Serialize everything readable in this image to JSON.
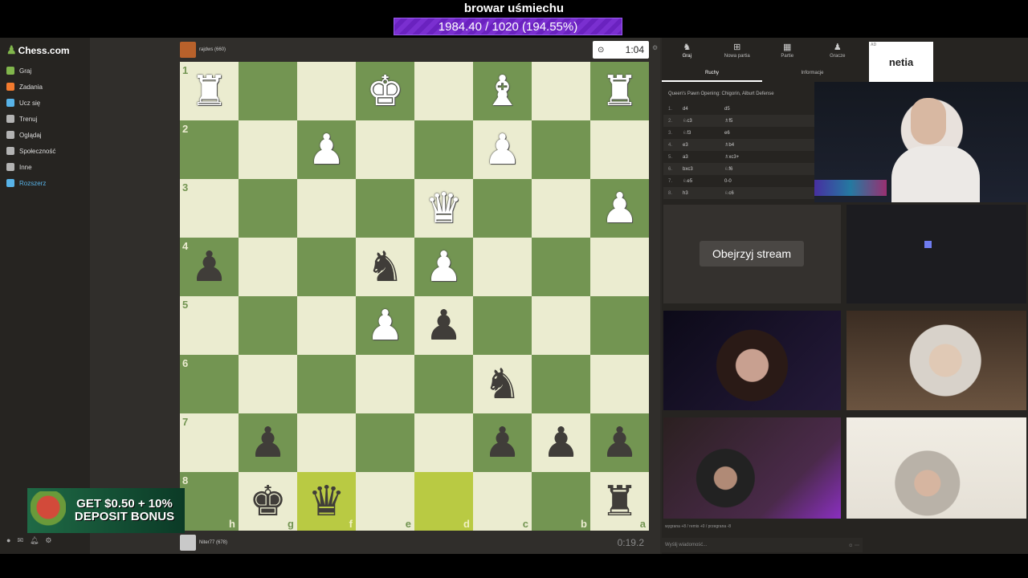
{
  "stream": {
    "title": "browar uśmiechu",
    "progress_text": "1984.40 / 1020 (194.55%)"
  },
  "sidebar": {
    "logo": "Chess.com",
    "items": [
      {
        "label": "Graj",
        "color": "#81b64c"
      },
      {
        "label": "Zadania",
        "color": "#f27a2e"
      },
      {
        "label": "Ucz się",
        "color": "#58b3e8"
      },
      {
        "label": "Trenuj",
        "color": "#b3b3b3"
      },
      {
        "label": "Oglądaj",
        "color": "#b3b3b3"
      },
      {
        "label": "Społeczność",
        "color": "#b3b3b3"
      },
      {
        "label": "Inne",
        "color": "#b3b3b3"
      },
      {
        "label": "Rozszerz",
        "color": "#58b3e8"
      }
    ]
  },
  "players": {
    "top": {
      "name": "rajdws (660)",
      "clock": "1:04"
    },
    "bottom": {
      "name": "Niter77 (678)",
      "clock": "0:19.2"
    }
  },
  "board": {
    "ranks": [
      "1",
      "2",
      "3",
      "4",
      "5",
      "6",
      "7",
      "8"
    ],
    "files": [
      "h",
      "g",
      "f",
      "e",
      "d",
      "c",
      "b",
      "a"
    ],
    "highlight": [
      "8-2",
      "8-4"
    ],
    "pieces": {
      "1-0": "wR",
      "1-3": "wK",
      "1-5": "wB",
      "1-7": "wR",
      "2-2": "wP",
      "2-5": "wP",
      "3-4": "wQ",
      "3-7": "wP",
      "4-0": "bP",
      "4-3": "bN",
      "4-4": "wP",
      "5-3": "wP",
      "5-4": "bP",
      "6-5": "bN",
      "7-1": "bP",
      "7-5": "bP",
      "7-6": "bP",
      "7-7": "bP",
      "8-1": "bK",
      "8-2": "bQ",
      "8-7": "bR"
    }
  },
  "ad": {
    "text": "GET $0.50 + 10% DEPOSIT BONUS"
  },
  "rightpanel": {
    "tabs": [
      "Graj",
      "Nowa partia",
      "Partie",
      "Gracze"
    ],
    "subtabs": [
      "Ruchy",
      "Informacje"
    ],
    "opening": "Queen's Pawn Opening: Chigorin, Alburt Defense",
    "moves": [
      {
        "n": "1.",
        "w": "d4",
        "b": "d5"
      },
      {
        "n": "2.",
        "w": "♘c3",
        "b": "♗f5"
      },
      {
        "n": "3.",
        "w": "♘f3",
        "b": "e6"
      },
      {
        "n": "4.",
        "w": "e3",
        "b": "♗b4"
      },
      {
        "n": "5.",
        "w": "a3",
        "b": "♗xc3+"
      },
      {
        "n": "6.",
        "w": "bxc3",
        "b": "♘f6"
      },
      {
        "n": "7.",
        "w": "♘e5",
        "b": "0-0"
      },
      {
        "n": "8.",
        "w": "h3",
        "b": "♘c6"
      }
    ],
    "ad_brand": "netia",
    "watch_label": "Obejrzyj stream",
    "record": "wygrana +8 / remis +0 / przegrana -8",
    "message_placeholder": "Wyślij wiadomość..."
  }
}
